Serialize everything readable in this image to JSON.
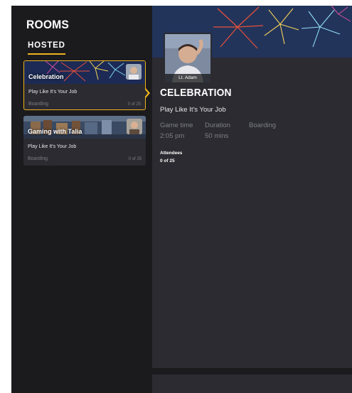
{
  "sidebar": {
    "title": "ROOMS",
    "tab": "HOSTED",
    "cards": [
      {
        "name": "Celebration",
        "subtitle": "Play Like It's Your Job",
        "status": "Boarding",
        "count": "0 of 25"
      },
      {
        "name": "Gaming with Talia",
        "subtitle": "Play Like It's Your Job",
        "status": "Boarding",
        "count": "0 of 25"
      }
    ]
  },
  "detail": {
    "host_tag": "Lt. Adam",
    "title": "CELEBRATION",
    "subtitle": "Play Like It's Your Job",
    "meta": {
      "game_time_label": "Game time",
      "game_time_value": "2:05 pm",
      "duration_label": "Duration",
      "duration_value": "50 mins",
      "status_label": "Boarding"
    },
    "attendees_label": "Attendees",
    "attendees_value": "0 of 25"
  },
  "colors": {
    "accent": "#f0b21d",
    "background": "#1b1b1e",
    "panel": "#2b2b31",
    "muted_text": "#7f7f88"
  }
}
